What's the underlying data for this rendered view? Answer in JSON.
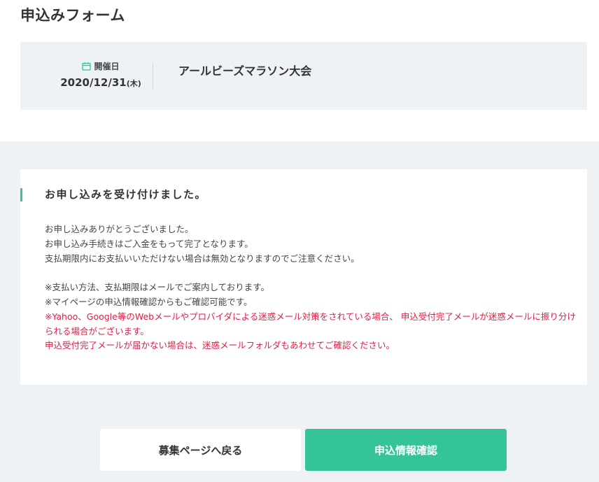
{
  "header": {
    "title": "申込みフォーム"
  },
  "event": {
    "date_label": "開催日",
    "date_value": "2020/12/31",
    "day_of_week": "(木)",
    "name": "アールビーズマラソン大会"
  },
  "message": {
    "heading": "お申し込みを受け付けました。",
    "lines": [
      "お申し込みありがとうございました。",
      "お申し込み手続きはご入金をもって完了となります。",
      "支払期限内にお支払いいただけない場合は無効となりますのでご注意ください。"
    ],
    "notes": [
      "※支払い方法、支払期限はメールでご案内しております。",
      "※マイページの申込情報確認からもご確認可能です。"
    ],
    "warning_1": "※Yahoo、Google等のWebメールやプロバイダによる迷惑メール対策をされている場合、 申込受付完了メールが迷惑メールに振り分けられる場合がございます。",
    "warning_2": "申込受付完了メールが届かない場合は、迷惑メールフォルダもあわせてご確認ください。"
  },
  "actions": {
    "back_label": "募集ページへ戻る",
    "confirm_label": "申込情報確認"
  },
  "colors": {
    "accent": "#35c497",
    "warning": "#dd1f45",
    "panel_bg": "#eff2f5"
  },
  "icons": {
    "date": "calendar-icon"
  }
}
